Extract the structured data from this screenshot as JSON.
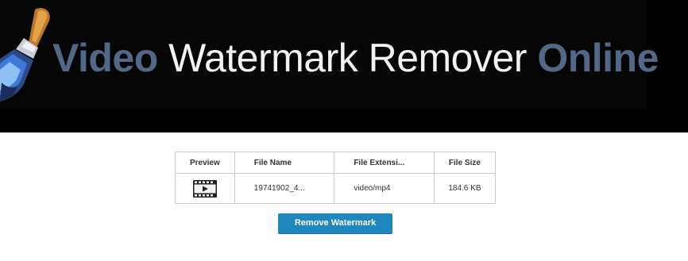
{
  "banner": {
    "title_part1": "Video",
    "title_part2": " Watermark Remover ",
    "title_part3": "Online"
  },
  "table": {
    "headers": [
      "Preview",
      "File Name",
      "File Extensi...",
      "File Size"
    ],
    "rows": [
      {
        "preview_icon": "video-file-icon",
        "file_name": "19741902_4...",
        "file_extension": "video/mp4",
        "file_size": "184.6 KB"
      }
    ]
  },
  "actions": {
    "remove_watermark_label": "Remove Watermark"
  },
  "colors": {
    "brand_blue": "#536786",
    "button_blue": "#1f87c0",
    "banner_bg": "#000000"
  }
}
